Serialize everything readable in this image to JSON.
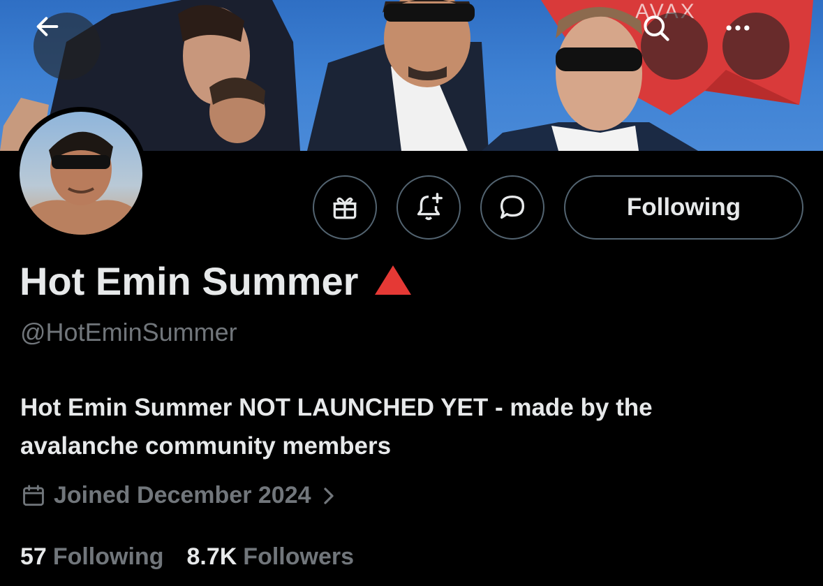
{
  "header": {
    "banner_flag_text": "AVAX",
    "back_icon": "arrow-left-icon",
    "search_icon": "search-icon",
    "more_icon": "more-horizontal-icon"
  },
  "actions": {
    "gift_icon": "gift-icon",
    "notify_icon": "bell-plus-icon",
    "message_icon": "message-bubble-icon",
    "follow_label": "Following"
  },
  "profile": {
    "display_name": "Hot Emin Summer",
    "name_badge": "red-triangle-icon",
    "handle": "@HotEminSummer",
    "bio_line1": "Hot Emin Summer NOT LAUNCHED YET - made by the",
    "bio_line2": "avalanche community members",
    "joined": "Joined December 2024"
  },
  "stats": {
    "following_count": "57",
    "following_label": "Following",
    "followers_count": "8.7K",
    "followers_label": "Followers"
  },
  "colors": {
    "background": "#000000",
    "text_primary": "#e7e9ea",
    "text_secondary": "#71767b",
    "button_border": "#536471",
    "badge_red": "#e53935",
    "flag_red": "#d93a3a",
    "sky_blue": "#3f82d4"
  }
}
